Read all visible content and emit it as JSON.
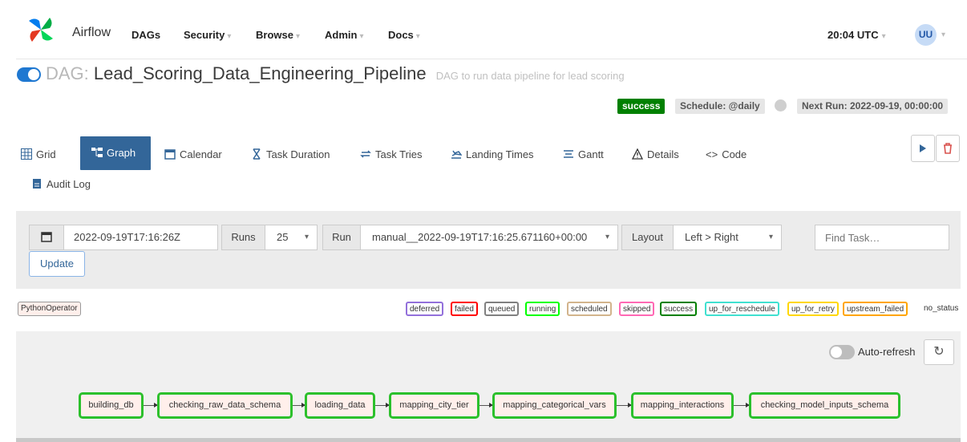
{
  "app": {
    "brand": "Airflow",
    "nav": [
      {
        "label": "DAGs"
      },
      {
        "label": "Security"
      },
      {
        "label": "Browse"
      },
      {
        "label": "Admin"
      },
      {
        "label": "Docs"
      }
    ],
    "clock": "20:04 UTC",
    "user_initials": "UU"
  },
  "dag": {
    "prefix": "DAG:",
    "dag_id": "Lead_Scoring_Data_Engineering_Pipeline",
    "description": "DAG to run data pipeline for lead scoring",
    "paused": false,
    "status_badge": "success",
    "schedule": "Schedule: @daily",
    "next_run": "Next Run: 2022-09-19, 00:00:00"
  },
  "tabs": [
    {
      "label": "Grid",
      "icon": "grid-icon"
    },
    {
      "label": "Graph",
      "icon": "graph-icon",
      "active": true
    },
    {
      "label": "Calendar",
      "icon": "calendar-icon"
    },
    {
      "label": "Task Duration",
      "icon": "hourglass-icon"
    },
    {
      "label": "Task Tries",
      "icon": "retry-icon"
    },
    {
      "label": "Landing Times",
      "icon": "landing-icon"
    },
    {
      "label": "Gantt",
      "icon": "gantt-icon"
    },
    {
      "label": "Details",
      "icon": "warning-triangle-icon"
    },
    {
      "label": "Code",
      "icon": "code-icon"
    },
    {
      "label": "Audit Log",
      "icon": "audit-log-icon"
    }
  ],
  "filters": {
    "base_date": "2022-09-19T17:16:26Z",
    "runs_label": "Runs",
    "runs_value": "25",
    "run_label": "Run",
    "run_value": "manual__2022-09-19T17:16:25.671160+00:00",
    "layout_label": "Layout",
    "layout_value": "Left > Right",
    "find_placeholder": "Find Task…",
    "update_label": "Update"
  },
  "legend": {
    "operator": "PythonOperator",
    "states": [
      {
        "label": "deferred",
        "color": "#9370db"
      },
      {
        "label": "failed",
        "color": "#ff0000"
      },
      {
        "label": "queued",
        "color": "#808080"
      },
      {
        "label": "running",
        "color": "#00ff00"
      },
      {
        "label": "scheduled",
        "color": "#d2b48c"
      },
      {
        "label": "skipped",
        "color": "#ff69b4"
      },
      {
        "label": "success",
        "color": "#008000"
      },
      {
        "label": "up_for_reschedule",
        "color": "#40e0d0"
      },
      {
        "label": "up_for_retry",
        "color": "#ffd700"
      },
      {
        "label": "upstream_failed",
        "color": "#ffa500"
      }
    ],
    "no_status": "no_status"
  },
  "graph": {
    "auto_refresh_label": "Auto-refresh",
    "auto_refresh_on": false,
    "tasks": [
      {
        "id": "building_db"
      },
      {
        "id": "checking_raw_data_schema"
      },
      {
        "id": "loading_data"
      },
      {
        "id": "mapping_city_tier"
      },
      {
        "id": "mapping_categorical_vars"
      },
      {
        "id": "mapping_interactions"
      },
      {
        "id": "checking_model_inputs_schema"
      }
    ],
    "node_border_color": "#2cc02c",
    "node_fill_color": "#ffefeb"
  }
}
